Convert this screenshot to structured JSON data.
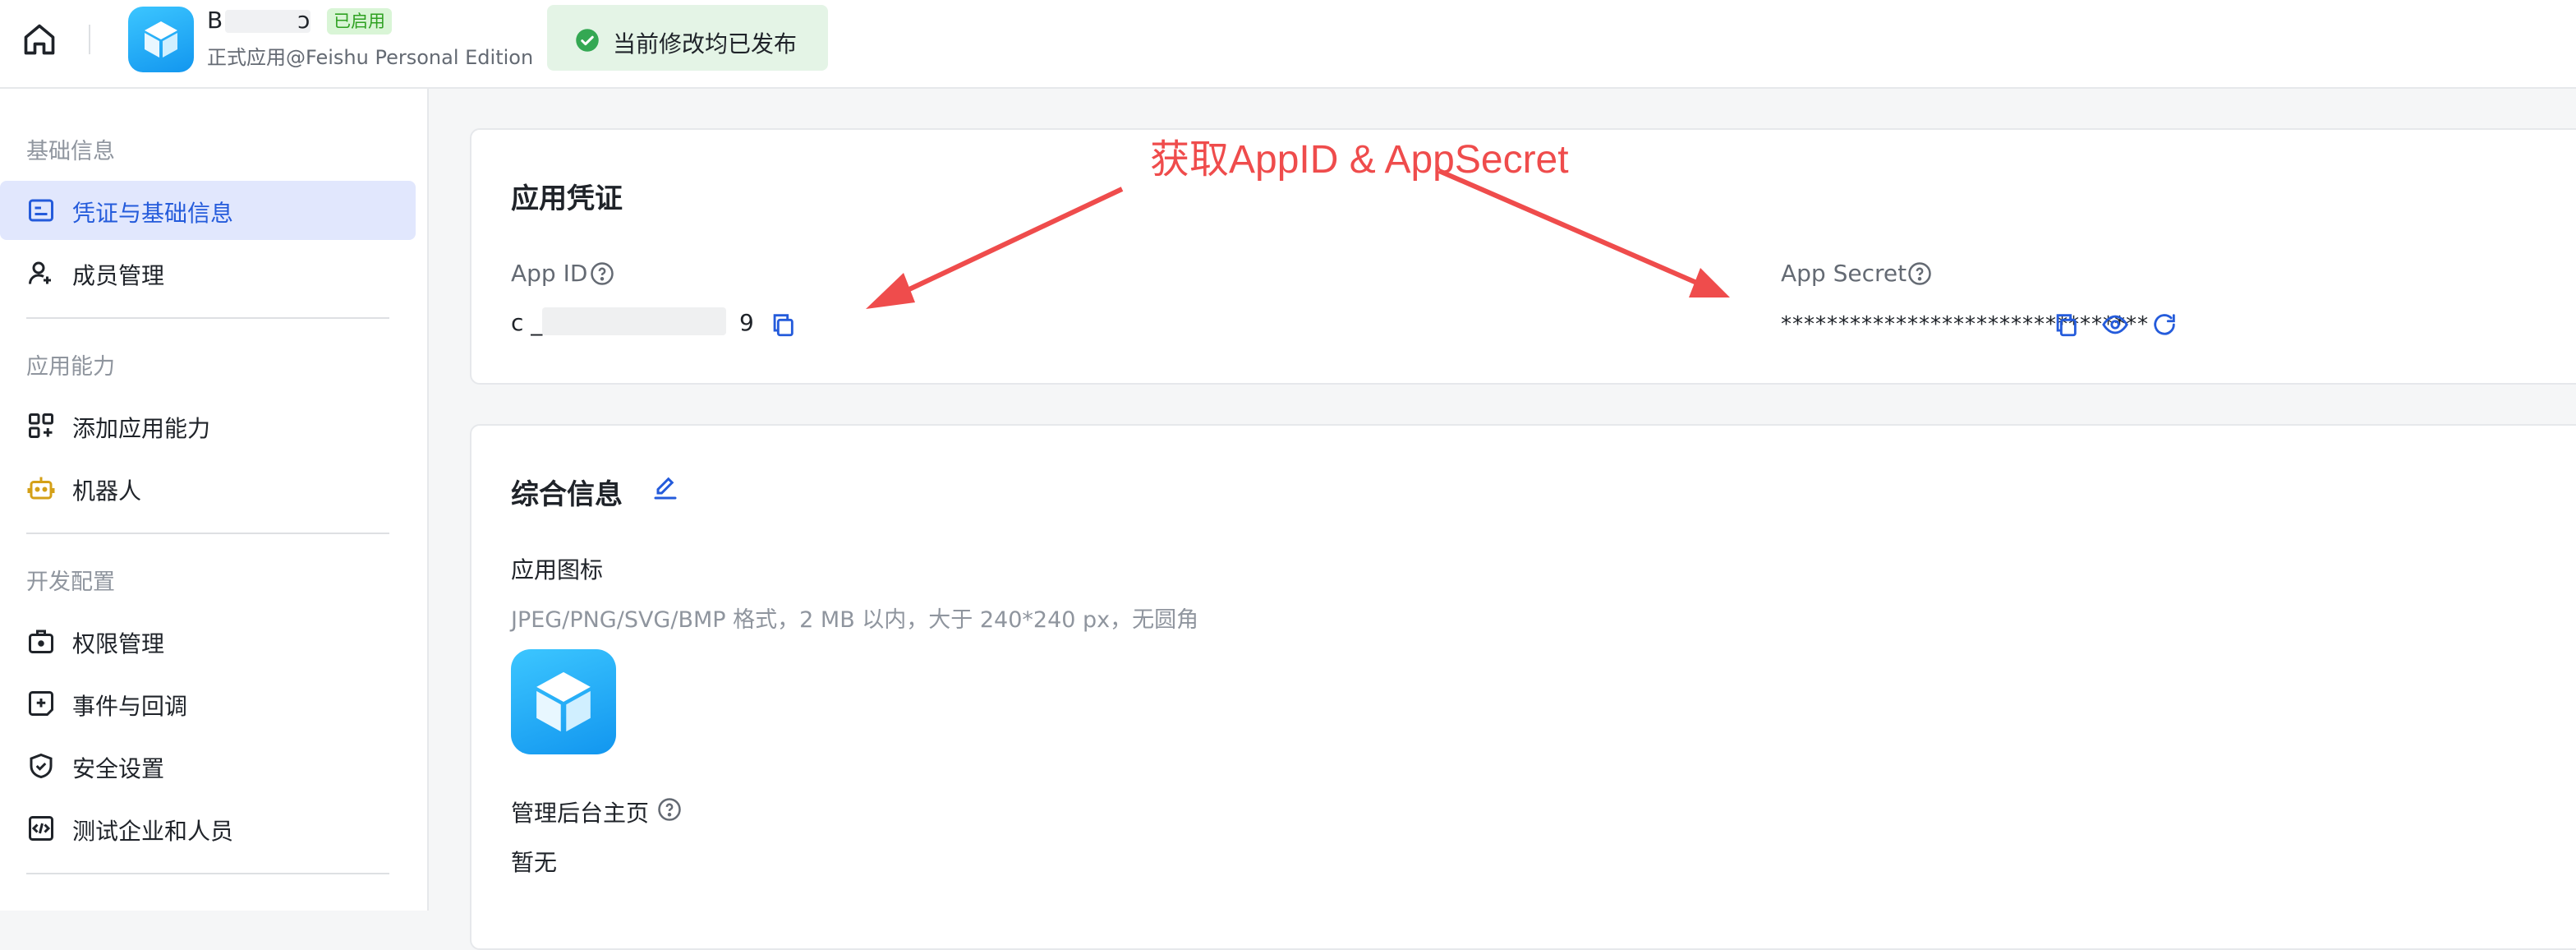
{
  "topbar": {
    "app_name_start": "B",
    "app_name_end": "ↄ",
    "status_tag": "已启用",
    "app_subtitle": "正式应用@Feishu Personal Edition",
    "toast": "当前修改均已发布"
  },
  "sidebar": {
    "groups": [
      "基础信息",
      "应用能力",
      "开发配置"
    ],
    "items": [
      {
        "label": "凭证与基础信息",
        "icon": "credential-card-icon",
        "active": true
      },
      {
        "label": "成员管理",
        "icon": "user-add-icon"
      },
      {
        "label": "添加应用能力",
        "icon": "grid-add-icon"
      },
      {
        "label": "机器人",
        "icon": "robot-icon"
      },
      {
        "label": "权限管理",
        "icon": "briefcase-lock-icon"
      },
      {
        "label": "事件与回调",
        "icon": "event-plus-icon"
      },
      {
        "label": "安全设置",
        "icon": "shield-icon"
      },
      {
        "label": "测试企业和人员",
        "icon": "code-box-icon"
      }
    ]
  },
  "credentials": {
    "title": "应用凭证",
    "app_id_label": "App ID",
    "app_id_start": "c _",
    "app_id_end": "9",
    "app_secret_label": "App Secret",
    "app_secret_value": "********************************"
  },
  "overview": {
    "title": "综合信息",
    "app_icon_label": "应用图标",
    "app_icon_hint": "JPEG/PNG/SVG/BMP 格式，2 MB 以内，大于 240*240 px，无圆角",
    "homepage_label": "管理后台主页",
    "homepage_value": "暂无"
  },
  "annotation": {
    "text": "获取AppID & AppSecret",
    "color": "#ef4c4c"
  },
  "colors": {
    "accent": "#245bdb",
    "active_bg": "#e1e7fd",
    "success": "#2ea121"
  }
}
